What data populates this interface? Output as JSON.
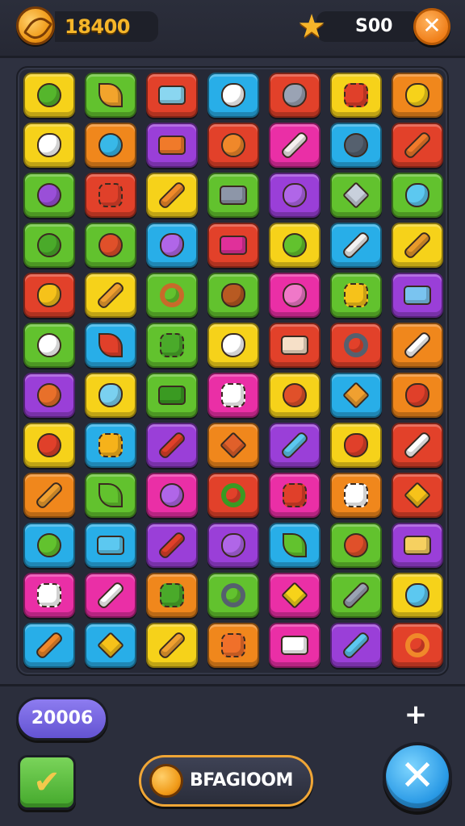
{
  "header": {
    "coins": "18400",
    "stars": "S00",
    "close_symbol": "✕"
  },
  "footer": {
    "score": "20006",
    "plus_symbol": "+",
    "check_symbol": "✔",
    "boost_label": "BFAGIOOM",
    "close_symbol": "✕"
  },
  "colors": {
    "yellow": "#f6d21a",
    "green": "#62c22e",
    "red": "#e2412a",
    "blue": "#28aee8",
    "orange": "#f0871c",
    "purple": "#9a3fd8",
    "pink": "#ea2fa6"
  },
  "grid": [
    [
      {
        "bg": "yellow",
        "icon": "ring-target-icon",
        "shape": "round",
        "fg": "#55b62c"
      },
      {
        "bg": "green",
        "icon": "leaf-icon",
        "shape": "leaf",
        "fg": "#f2a42c"
      },
      {
        "bg": "red",
        "icon": "tv-icon",
        "shape": "rect",
        "fg": "#8ad6f0"
      },
      {
        "bg": "blue",
        "icon": "cloud-icon",
        "shape": "blob",
        "fg": "#ffffff"
      },
      {
        "bg": "red",
        "icon": "boot-icon",
        "shape": "blob",
        "fg": "#9aa3b4"
      },
      {
        "bg": "yellow",
        "icon": "flower-icon",
        "shape": "gear",
        "fg": "#e0402a"
      },
      {
        "bg": "orange",
        "icon": "bird-icon",
        "shape": "blob",
        "fg": "#f6d21a"
      }
    ],
    [
      {
        "bg": "yellow",
        "icon": "cloud-icon",
        "shape": "blob",
        "fg": "#ffffff"
      },
      {
        "bg": "orange",
        "icon": "ball-icon",
        "shape": "round",
        "fg": "#38b8e8"
      },
      {
        "bg": "purple",
        "icon": "box-icon",
        "shape": "rect",
        "fg": "#f07a2a"
      },
      {
        "bg": "red",
        "icon": "cookie-icon",
        "shape": "round",
        "fg": "#f0882a"
      },
      {
        "bg": "pink",
        "icon": "pencil-icon",
        "shape": "stick",
        "fg": "#f6f0f0"
      },
      {
        "bg": "blue",
        "icon": "bomb-icon",
        "shape": "round",
        "fg": "#55606e"
      },
      {
        "bg": "red",
        "icon": "crayon-icon",
        "shape": "stick",
        "fg": "#f07a2a"
      }
    ],
    [
      {
        "bg": "green",
        "icon": "lollipop-icon",
        "shape": "round",
        "fg": "#9a4fd8"
      },
      {
        "bg": "red",
        "icon": "gear-icon",
        "shape": "gear",
        "fg": "#e0402a"
      },
      {
        "bg": "yellow",
        "icon": "bar-icon",
        "shape": "stick",
        "fg": "#f08a2a"
      },
      {
        "bg": "green",
        "icon": "bag-icon",
        "shape": "rect",
        "fg": "#8d96a8"
      },
      {
        "bg": "purple",
        "icon": "blob-icon",
        "shape": "blob",
        "fg": "#b066e8"
      },
      {
        "bg": "green",
        "icon": "crystal-icon",
        "shape": "star",
        "fg": "#c8d0dc"
      },
      {
        "bg": "green",
        "icon": "ghost-icon",
        "shape": "blob",
        "fg": "#5cc8f0"
      }
    ],
    [
      {
        "bg": "green",
        "icon": "ball-icon",
        "shape": "round",
        "fg": "#4aaa2a"
      },
      {
        "bg": "green",
        "icon": "ball-icon",
        "shape": "round",
        "fg": "#e0502a"
      },
      {
        "bg": "blue",
        "icon": "face-icon",
        "shape": "blob",
        "fg": "#b066e8"
      },
      {
        "bg": "red",
        "icon": "cube-icon",
        "shape": "rect",
        "fg": "#e0309a"
      },
      {
        "bg": "yellow",
        "icon": "ball-icon",
        "shape": "round",
        "fg": "#62c22e"
      },
      {
        "bg": "blue",
        "icon": "scroll-icon",
        "shape": "stick",
        "fg": "#f2f2f2"
      },
      {
        "bg": "yellow",
        "icon": "bar-icon",
        "shape": "stick",
        "fg": "#e89a2a"
      }
    ],
    [
      {
        "bg": "red",
        "icon": "bird-icon",
        "shape": "blob",
        "fg": "#f6c21a"
      },
      {
        "bg": "yellow",
        "icon": "pencil-icon",
        "shape": "stick",
        "fg": "#f0a030"
      },
      {
        "bg": "green",
        "icon": "magnifier-icon",
        "shape": "ring",
        "fg": "#c86a2a"
      },
      {
        "bg": "green",
        "icon": "bird-icon",
        "shape": "blob",
        "fg": "#b85a22"
      },
      {
        "bg": "pink",
        "icon": "face-icon",
        "shape": "blob",
        "fg": "#f078c8"
      },
      {
        "bg": "green",
        "icon": "flower-icon",
        "shape": "gear",
        "fg": "#f6c21a"
      },
      {
        "bg": "purple",
        "icon": "tv-icon",
        "shape": "rect",
        "fg": "#7ac4f0"
      }
    ],
    [
      {
        "bg": "green",
        "icon": "mushroom-icon",
        "shape": "round",
        "fg": "#ffffff"
      },
      {
        "bg": "blue",
        "icon": "chili-icon",
        "shape": "leaf",
        "fg": "#e0402a"
      },
      {
        "bg": "green",
        "icon": "gear-icon",
        "shape": "gear",
        "fg": "#4aaa2a"
      },
      {
        "bg": "yellow",
        "icon": "cloud-icon",
        "shape": "blob",
        "fg": "#ffffff"
      },
      {
        "bg": "red",
        "icon": "camera-icon",
        "shape": "rect",
        "fg": "#f6e0c8"
      },
      {
        "bg": "red",
        "icon": "ring-icon",
        "shape": "ring",
        "fg": "#55606e"
      },
      {
        "bg": "orange",
        "icon": "pencil-icon",
        "shape": "stick",
        "fg": "#ffffff"
      }
    ],
    [
      {
        "bg": "purple",
        "icon": "apple-icon",
        "shape": "round",
        "fg": "#e8702a"
      },
      {
        "bg": "yellow",
        "icon": "cloud-icon",
        "shape": "blob",
        "fg": "#7ad0f0"
      },
      {
        "bg": "green",
        "icon": "square-icon",
        "shape": "rect",
        "fg": "#3a9a22"
      },
      {
        "bg": "pink",
        "icon": "ghost-icon",
        "shape": "gear",
        "fg": "#ffffff"
      },
      {
        "bg": "yellow",
        "icon": "ball-icon",
        "shape": "round",
        "fg": "#e0502a"
      },
      {
        "bg": "blue",
        "icon": "sticks-icon",
        "shape": "star",
        "fg": "#f0a030"
      },
      {
        "bg": "orange",
        "icon": "bird-icon",
        "shape": "blob",
        "fg": "#e0402a"
      }
    ],
    [
      {
        "bg": "yellow",
        "icon": "apple-icon",
        "shape": "round",
        "fg": "#e0402a"
      },
      {
        "bg": "blue",
        "icon": "gear-icon",
        "shape": "gear",
        "fg": "#f6b21a"
      },
      {
        "bg": "purple",
        "icon": "candy-icon",
        "shape": "stick",
        "fg": "#e0402a"
      },
      {
        "bg": "orange",
        "icon": "cross-icon",
        "shape": "star",
        "fg": "#e0602a"
      },
      {
        "bg": "purple",
        "icon": "crayon-icon",
        "shape": "stick",
        "fg": "#5cc8f0"
      },
      {
        "bg": "yellow",
        "icon": "heart-icon",
        "shape": "blob",
        "fg": "#e0402a"
      },
      {
        "bg": "red",
        "icon": "pencil-icon",
        "shape": "stick",
        "fg": "#ffffff"
      }
    ],
    [
      {
        "bg": "orange",
        "icon": "bar-icon",
        "shape": "stick",
        "fg": "#f0a030"
      },
      {
        "bg": "green",
        "icon": "leaf-icon",
        "shape": "leaf",
        "fg": "#62c22e"
      },
      {
        "bg": "pink",
        "icon": "face-icon",
        "shape": "round",
        "fg": "#b066e8"
      },
      {
        "bg": "red",
        "icon": "magnifier-icon",
        "shape": "ring",
        "fg": "#3a9a22"
      },
      {
        "bg": "pink",
        "icon": "ball-icon",
        "shape": "gear",
        "fg": "#e0402a"
      },
      {
        "bg": "orange",
        "icon": "gear-icon",
        "shape": "gear",
        "fg": "#ffffff"
      },
      {
        "bg": "red",
        "icon": "lightning-icon",
        "shape": "star",
        "fg": "#f6c21a"
      }
    ],
    [
      {
        "bg": "blue",
        "icon": "ball-icon",
        "shape": "round",
        "fg": "#62c22e"
      },
      {
        "bg": "blue",
        "icon": "box-icon",
        "shape": "rect",
        "fg": "#5cc8f0"
      },
      {
        "bg": "purple",
        "icon": "pencil-icon",
        "shape": "stick",
        "fg": "#e0402a"
      },
      {
        "bg": "purple",
        "icon": "face-icon",
        "shape": "blob",
        "fg": "#b066e8"
      },
      {
        "bg": "blue",
        "icon": "palm-icon",
        "shape": "leaf",
        "fg": "#62c22e"
      },
      {
        "bg": "green",
        "icon": "ball-icon",
        "shape": "round",
        "fg": "#e0502a"
      },
      {
        "bg": "purple",
        "icon": "box-icon",
        "shape": "rect",
        "fg": "#f6d060"
      }
    ],
    [
      {
        "bg": "pink",
        "icon": "gear-icon",
        "shape": "gear",
        "fg": "#ffffff"
      },
      {
        "bg": "pink",
        "icon": "bottle-icon",
        "shape": "stick",
        "fg": "#ffffff"
      },
      {
        "bg": "orange",
        "icon": "flower-icon",
        "shape": "gear",
        "fg": "#4aaa2a"
      },
      {
        "bg": "green",
        "icon": "magnifier-icon",
        "shape": "ring",
        "fg": "#55606e"
      },
      {
        "bg": "pink",
        "icon": "star-icon",
        "shape": "star",
        "fg": "#f6d21a"
      },
      {
        "bg": "green",
        "icon": "pill-icon",
        "shape": "stick",
        "fg": "#9aa3b4"
      },
      {
        "bg": "yellow",
        "icon": "cloud-icon",
        "shape": "blob",
        "fg": "#5cc8f0"
      }
    ],
    [
      {
        "bg": "blue",
        "icon": "crayon-icon",
        "shape": "stick",
        "fg": "#f0882a"
      },
      {
        "bg": "blue",
        "icon": "lightning-icon",
        "shape": "star",
        "fg": "#f6c21a"
      },
      {
        "bg": "yellow",
        "icon": "bar-icon",
        "shape": "stick",
        "fg": "#f0a030"
      },
      {
        "bg": "orange",
        "icon": "cookie-icon",
        "shape": "gear",
        "fg": "#f0702a"
      },
      {
        "bg": "pink",
        "icon": "calendar-icon",
        "shape": "rect",
        "fg": "#ffffff"
      },
      {
        "bg": "purple",
        "icon": "pill-icon",
        "shape": "stick",
        "fg": "#5cc8f0"
      },
      {
        "bg": "red",
        "icon": "scissors-icon",
        "shape": "ring",
        "fg": "#f0882a"
      }
    ]
  ]
}
